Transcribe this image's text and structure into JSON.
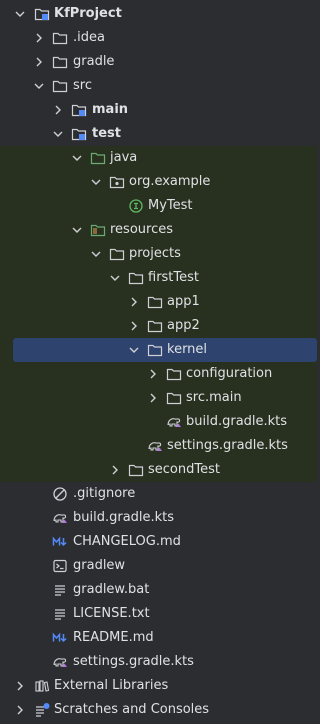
{
  "tree": {
    "root": "KfProject",
    "idea": ".idea",
    "gradle": "gradle",
    "src": "src",
    "main": "main",
    "test": "test",
    "java": "java",
    "org_example": "org.example",
    "mytest": "MyTest",
    "resources": "resources",
    "projects": "projects",
    "firsttest": "firstTest",
    "app1": "app1",
    "app2": "app2",
    "kernel": "kernel",
    "configuration": "configuration",
    "src_main": "src.main",
    "build_gradle_kts_kernel": "build.gradle.kts",
    "settings_gradle_kts_firsttest": "settings.gradle.kts",
    "secondtest": "secondTest",
    "gitignore": ".gitignore",
    "build_gradle_kts_root": "build.gradle.kts",
    "changelog": "CHANGELOG.md",
    "gradlew": "gradlew",
    "gradlew_bat": "gradlew.bat",
    "license": "LICENSE.txt",
    "readme": "README.md",
    "settings_gradle_kts_root": "settings.gradle.kts",
    "external_libraries": "External Libraries",
    "scratches": "Scratches and Consoles"
  },
  "colors": {
    "background": "#2b2d30",
    "test_scope_highlight": "#28311f",
    "selection": "#2e436e",
    "text": "#dfe1e5",
    "folder_icon": "#ced0d6",
    "java_source_folder": "#6aab73",
    "test_class_icon": "#5fb865",
    "markdown_icon": "#548af7"
  }
}
